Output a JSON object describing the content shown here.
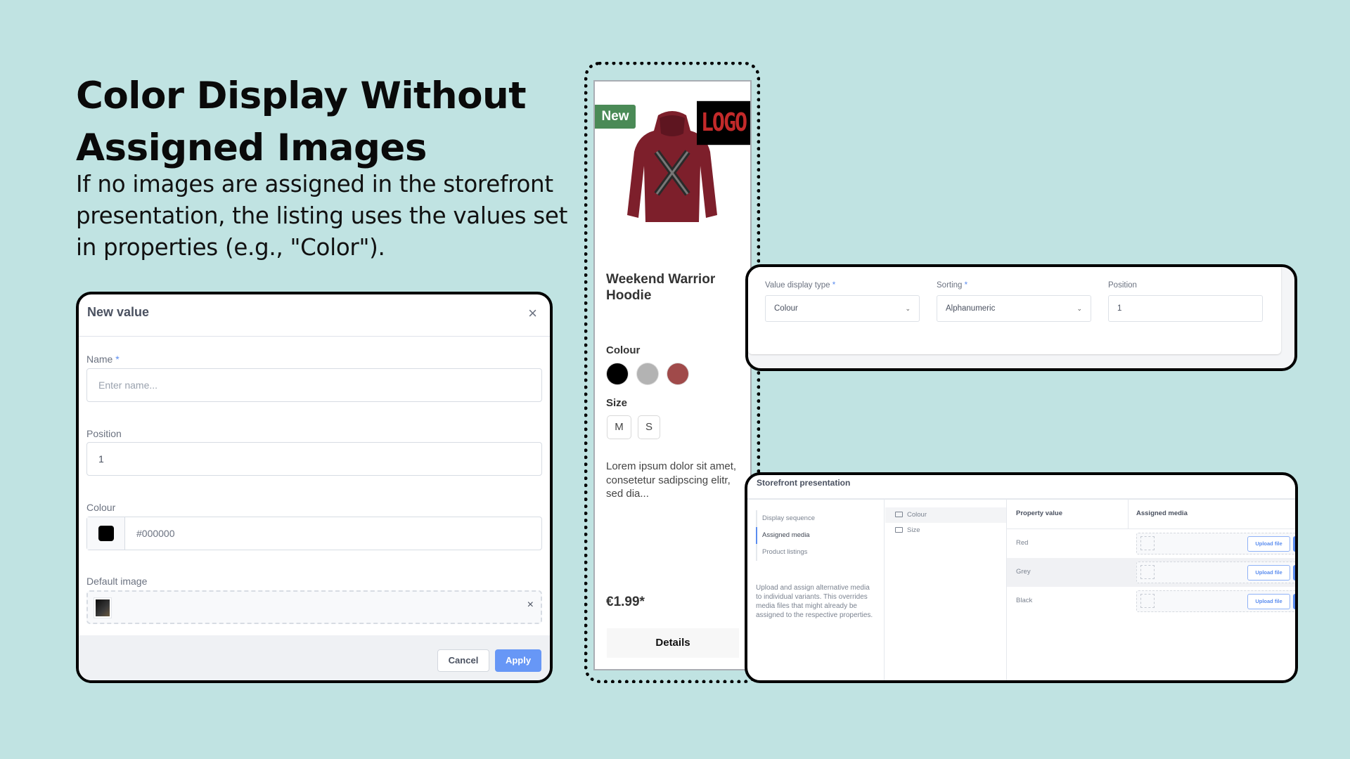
{
  "slide": {
    "headline": "Color Display Without Assigned Images",
    "subtext": "If no images are assigned in the storefront presentation, the listing uses the values set in properties (e.g., \"Color\")."
  },
  "dialog": {
    "title": "New value",
    "close_icon": "×",
    "name_label": "Name",
    "required_mark": "*",
    "name_placeholder": "Enter name...",
    "position_label": "Position",
    "position_value": "1",
    "colour_label": "Colour",
    "colour_value": "#000000",
    "default_image_label": "Default image",
    "remove_image_icon": "×",
    "cancel_label": "Cancel",
    "apply_label": "Apply"
  },
  "product": {
    "badge": "New",
    "logo": "LOGO",
    "name": "Weekend Warrior Hoodie",
    "colour_label": "Colour",
    "colours": [
      "#000000",
      "#b3b3b3",
      "#a04a4a"
    ],
    "size_label": "Size",
    "sizes": [
      "M",
      "S"
    ],
    "description": "Lorem ipsum dolor sit amet, consetetur sadipscing elitr, sed dia...",
    "price": "€1.99*",
    "details_label": "Details"
  },
  "settings": {
    "display_type_label": "Value display type",
    "display_type_value": "Colour",
    "sorting_label": "Sorting",
    "sorting_value": "Alphanumeric",
    "position_label": "Position",
    "position_value": "1",
    "required_mark": "*",
    "chevron": "⌄"
  },
  "storefront": {
    "title": "Storefront presentation",
    "nav": [
      "Display sequence",
      "Assigned media",
      "Product listings"
    ],
    "help_text": "Upload and assign alternative media to individual variants. This overrides media files that might already be assigned to the respective properties.",
    "tree": [
      "Colour",
      "Size"
    ],
    "columns": [
      "Property value",
      "Assigned media"
    ],
    "rows": [
      {
        "value": "Red",
        "upload_label": "Upload file"
      },
      {
        "value": "Grey",
        "upload_label": "Upload file"
      },
      {
        "value": "Black",
        "upload_label": "Upload file"
      }
    ]
  }
}
